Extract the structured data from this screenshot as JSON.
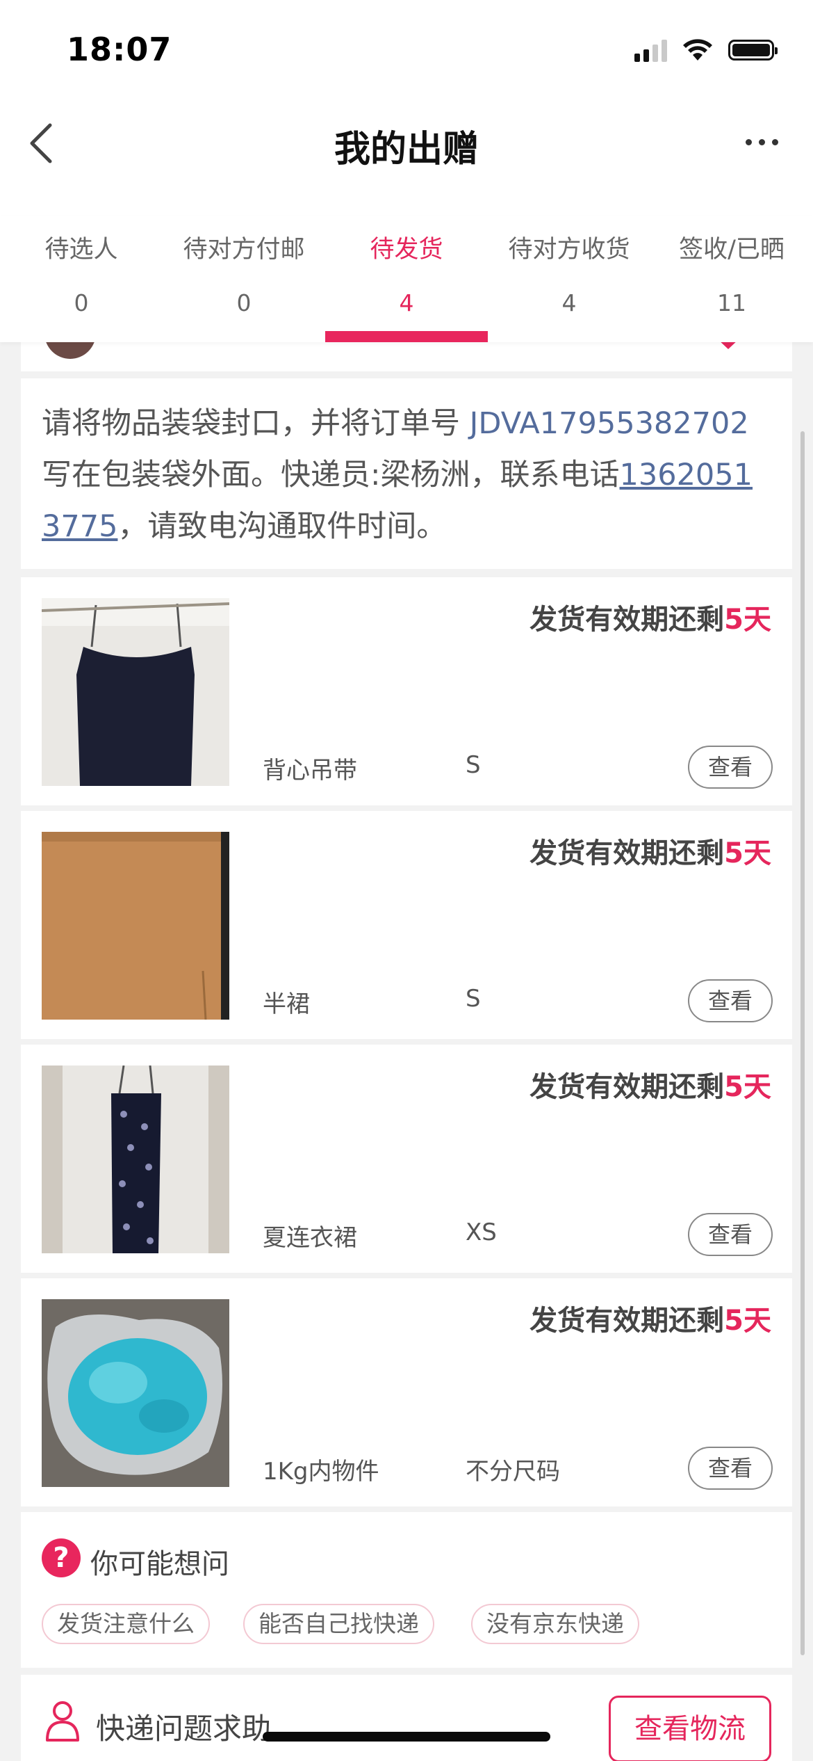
{
  "status_bar": {
    "time": "18:07"
  },
  "nav": {
    "title": "我的出赠"
  },
  "tabs": [
    {
      "label": "待选人",
      "count": "0"
    },
    {
      "label": "待对方付邮",
      "count": "0"
    },
    {
      "label": "待发货",
      "count": "4",
      "active": true
    },
    {
      "label": "待对方收货",
      "count": "4"
    },
    {
      "label": "签收/已晒",
      "count": "11"
    }
  ],
  "notice": {
    "text_before": "请将物品装袋封口，并将订单号 ",
    "order_no": "JDVA17955382702",
    "text_middle": " 写在包装袋外面。快递员:梁杨洲，联系电话",
    "phone": "13620513775",
    "text_after": "，请致电沟通取件时间。"
  },
  "items": [
    {
      "name": "背心吊带",
      "size": "S",
      "deadline_prefix": "发货有效期还剩",
      "deadline_days": "5天",
      "view_label": "查看"
    },
    {
      "name": "半裙",
      "size": "S",
      "deadline_prefix": "发货有效期还剩",
      "deadline_days": "5天",
      "view_label": "查看"
    },
    {
      "name": "夏连衣裙",
      "size": "XS",
      "deadline_prefix": "发货有效期还剩",
      "deadline_days": "5天",
      "view_label": "查看"
    },
    {
      "name": "1Kg内物件",
      "size": "不分尺码",
      "deadline_prefix": "发货有效期还剩",
      "deadline_days": "5天",
      "view_label": "查看"
    }
  ],
  "faq": {
    "title": "你可能想问",
    "chips": [
      "发货注意什么",
      "能否自己找快递",
      "没有京东快递"
    ]
  },
  "help": {
    "text": "快递问题求助",
    "button": "查看物流"
  },
  "colors": {
    "accent": "#e5265c",
    "link": "#546c9c",
    "background": "#f2f2f2"
  }
}
